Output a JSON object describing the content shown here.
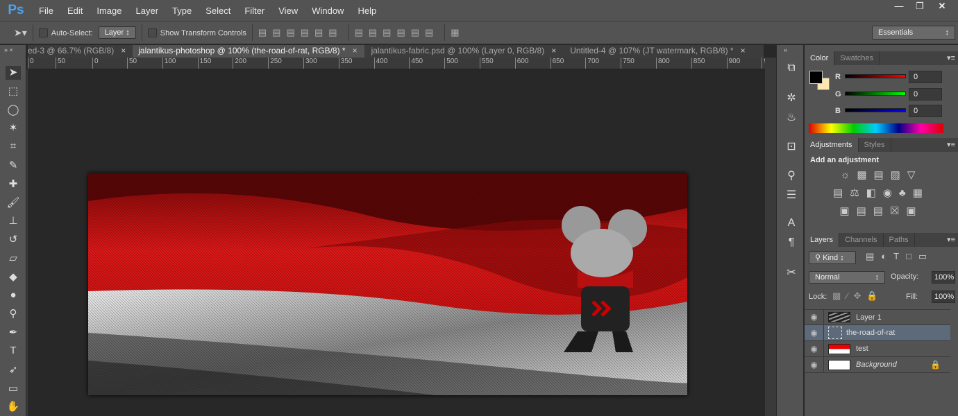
{
  "app": {
    "logo": "Ps",
    "menu": [
      "File",
      "Edit",
      "Image",
      "Layer",
      "Type",
      "Select",
      "Filter",
      "View",
      "Window",
      "Help"
    ],
    "window_controls": [
      "minimize",
      "restore",
      "close"
    ]
  },
  "options": {
    "auto_select_label": "Auto-Select:",
    "auto_select_checked": false,
    "layer_select": "Layer",
    "transform_label": "Show Transform Controls",
    "transform_checked": false,
    "workspace": "Essentials"
  },
  "tabs": [
    {
      "label": "ed-3 @ 66.7% (RGB/8)",
      "active": false
    },
    {
      "label": "jalantikus-photoshop @ 100% (the-road-of-rat, RGB/8) *",
      "active": true
    },
    {
      "label": "jalantikus-fabric.psd @ 100% (Layer 0, RGB/8)",
      "active": false
    },
    {
      "label": "Untitled-4 @ 107% (JT watermark, RGB/8) *",
      "active": false
    }
  ],
  "ruler": [
    "0",
    "50",
    "0",
    "50",
    "100",
    "150",
    "200",
    "250",
    "300",
    "350",
    "400",
    "450",
    "500",
    "550",
    "600",
    "650",
    "700",
    "750",
    "800",
    "850",
    "900",
    "9"
  ],
  "tools": [
    "move-icon",
    "marquee-icon",
    "lasso-icon",
    "magic-wand-icon",
    "crop-icon",
    "eyedropper-icon",
    "healing-icon",
    "brush-icon",
    "stamp-icon",
    "history-brush-icon",
    "eraser-icon",
    "paint-bucket-icon",
    "blur-icon",
    "dodge-icon",
    "pen-icon",
    "type-icon",
    "path-select-icon",
    "rectangle-icon",
    "hand-icon"
  ],
  "color_panel": {
    "tabs": [
      "Color",
      "Swatches"
    ],
    "foreground": "#000000",
    "background": "#fde9b0",
    "r": "0",
    "g": "0",
    "b": "0",
    "labels": [
      "R",
      "G",
      "B"
    ]
  },
  "adjustments": {
    "tabs": [
      "Adjustments",
      "Styles"
    ],
    "title": "Add an adjustment"
  },
  "layers_panel": {
    "tabs": [
      "Layers",
      "Channels",
      "Paths"
    ],
    "filter": "Kind",
    "blend_mode": "Normal",
    "opacity_label": "Opacity:",
    "opacity": "100%",
    "lock_label": "Lock:",
    "fill_label": "Fill:",
    "fill": "100%",
    "layers": [
      {
        "name": "Layer 1",
        "selected": false
      },
      {
        "name": "the-road-of-rat",
        "selected": true
      },
      {
        "name": "test",
        "selected": false
      },
      {
        "name": "Background",
        "selected": false,
        "locked": true
      }
    ]
  },
  "colors": {
    "accent": "#4da3ee",
    "selected_layer": "#5c6a7a"
  }
}
